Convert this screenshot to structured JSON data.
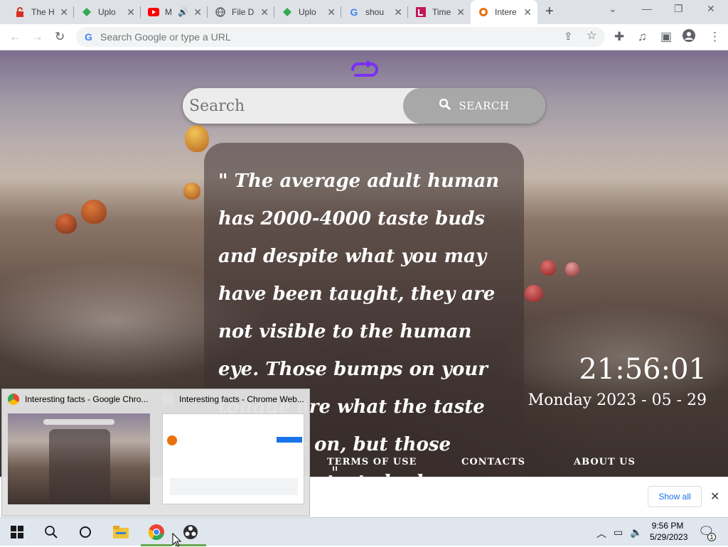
{
  "browser": {
    "tabs": [
      {
        "title": "The H",
        "favicon": "lock-red-icon"
      },
      {
        "title": "Uplo",
        "favicon": "upload-green-icon"
      },
      {
        "title": "M",
        "favicon": "youtube-icon"
      },
      {
        "title": "File D",
        "favicon": "globe-icon"
      },
      {
        "title": "Uplo",
        "favicon": "upload-green-icon"
      },
      {
        "title": "shou",
        "favicon": "google-icon"
      },
      {
        "title": "Time",
        "favicon": "time-icon"
      },
      {
        "title": "Intere",
        "favicon": "interesting-facts-icon",
        "active": true
      }
    ],
    "omnibox_placeholder": "Search Google or type a URL"
  },
  "page": {
    "search_placeholder": "Search",
    "search_button": "SEARCH",
    "quote": "\"  The average adult human has 2000-4000 taste buds and despite what you may have been taught, they are not visible to the human eye. Those bumps on your tongue are what the taste buds are on, but those aren't the taste buds",
    "quote_close": "\"",
    "clock": "21:56:01",
    "date": "Monday 2023 - 05 - 29",
    "footer": {
      "terms": "TERMS OF USE",
      "contacts": "CONTACTS",
      "about": "ABOUT US"
    }
  },
  "download_bar": {
    "show_all": "Show all"
  },
  "thumbnails": [
    {
      "title": "Interesting facts - Google Chro..."
    },
    {
      "title": "Interesting facts - Chrome Web..."
    }
  ],
  "taskbar": {
    "time": "9:56 PM",
    "date": "5/29/2023",
    "notification_count": "1"
  },
  "colors": {
    "accent_purple": "#7b2ff7",
    "chrome_blue": "#1a73e8",
    "taskbar_active": "#6aa84f"
  }
}
